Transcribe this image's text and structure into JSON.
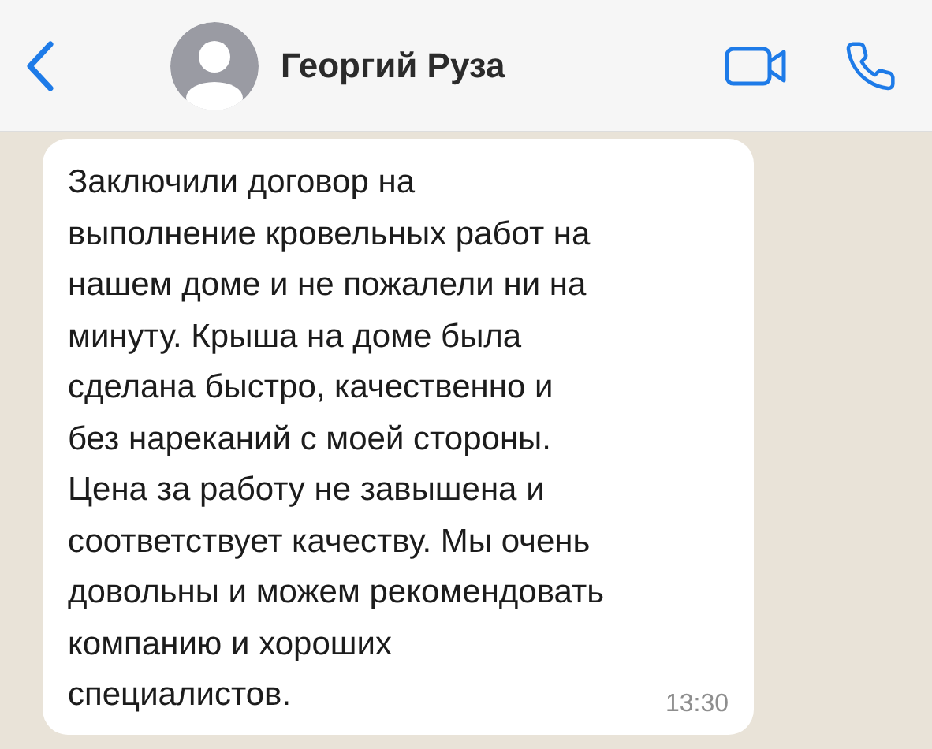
{
  "header": {
    "contact_name": "Георгий Руза"
  },
  "message": {
    "lines": [
      "Заключили договор на",
      "выполнение кровельных работ на",
      "нашем доме и не пожалели ни на",
      "минуту. Крыша на доме была",
      "сделана быстро, качественно и",
      "без нареканий с моей стороны.",
      "Цена за работу не завышена и",
      "соответствует качеству. Мы очень",
      "довольны и можем рекомендовать",
      "компанию и хороших",
      "специалистов."
    ],
    "time": "13:30"
  }
}
